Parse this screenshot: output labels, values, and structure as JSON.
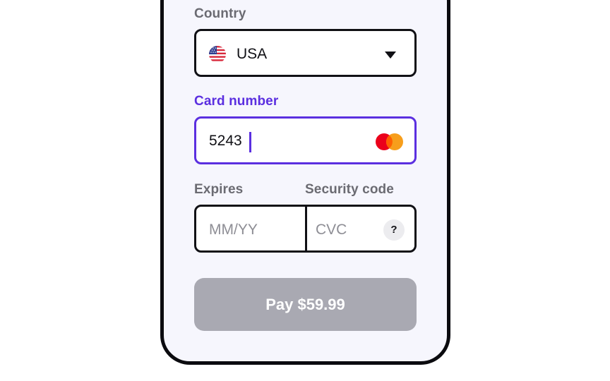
{
  "country": {
    "label": "Country",
    "selected": "USA",
    "flag_icon": "us-flag-icon"
  },
  "card": {
    "label": "Card number",
    "value": "5243",
    "brand_icon": "mastercard-icon",
    "accent_color": "#5b2fe0"
  },
  "expires": {
    "label": "Expires",
    "placeholder": "MM/YY"
  },
  "security": {
    "label": "Security code",
    "placeholder": "CVC",
    "help_label": "?"
  },
  "pay_button": {
    "label": "Pay $59.99",
    "color": "#a9a9b2"
  }
}
